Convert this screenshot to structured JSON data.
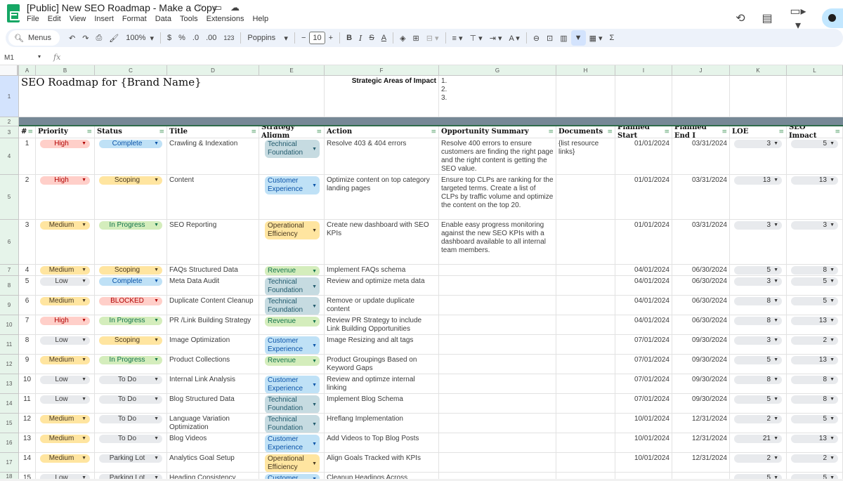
{
  "app": {
    "doc_title": "[Public] New SEO Roadmap - Make a Copy",
    "title_icons": [
      "star-icon",
      "move-to-folder-icon",
      "cloud-status-icon"
    ],
    "menu": [
      "File",
      "Edit",
      "View",
      "Insert",
      "Format",
      "Data",
      "Tools",
      "Extensions",
      "Help"
    ],
    "right_icons": [
      "version-history-icon",
      "comments-icon",
      "meet-icon"
    ]
  },
  "toolbar": {
    "search_menus": "Menus",
    "zoom": "100%",
    "currency": "$",
    "percent": "%",
    "decrease_decimal": ".0",
    "increase_decimal": ".00",
    "more_formats": "123",
    "font": "Poppins",
    "font_size": "10",
    "minus": "−",
    "plus": "+",
    "bold": "B",
    "italic": "I",
    "sum": "Σ"
  },
  "formula_bar": {
    "cell_ref": "M1",
    "fx": "fx",
    "value": ""
  },
  "columns": [
    "A",
    "B",
    "C",
    "D",
    "E",
    "F",
    "G",
    "H",
    "I",
    "J",
    "K",
    "L"
  ],
  "sheet": {
    "title": "SEO Roadmap for {Brand Name}",
    "strategic_label": "Strategic Areas of Impact",
    "strategic_list": "1.\n2.\n3.",
    "headers": [
      "#",
      "Priority",
      "Status",
      "Title",
      "Strategy Alignm",
      "Action",
      "Opportunity Summary",
      "Documents",
      "Planned Start",
      "Planned End I",
      "LOE",
      "SEO Impact"
    ],
    "row_numbers": [
      "1",
      "2",
      "3",
      "4",
      "5",
      "6",
      "7",
      "8",
      "9",
      "10",
      "11",
      "12",
      "13",
      "14",
      "15",
      "16",
      "17",
      "18"
    ],
    "rows": [
      {
        "n": "1",
        "priority": "High",
        "status": "Complete",
        "title": "Crawling & Indexation",
        "strategy": "Technical Foundation",
        "action": "Resolve 403 & 404 errors",
        "summary": "Resolve 400 errors to ensure customers are finding the right page and the right content is getting the SEO value.",
        "docs": "{list resource links}",
        "start": "01/01/2024",
        "end": "03/31/2024",
        "loe": "3",
        "impact": "5"
      },
      {
        "n": "2",
        "priority": "High",
        "status": "Scoping",
        "title": "Content",
        "strategy": "Customer Experience",
        "action": "Optimize content on top category landing pages",
        "summary": "Ensure top CLPs are ranking for the targeted terms. Create a list of CLPs by traffic volume and optimize the content on the top 20.",
        "docs": "",
        "start": "01/01/2024",
        "end": "03/31/2024",
        "loe": "13",
        "impact": "13"
      },
      {
        "n": "3",
        "priority": "Medium",
        "status": "In Progress",
        "title": "SEO Reporting",
        "strategy": "Operational Efficiency",
        "action": "Create new dashboard with SEO KPIs",
        "summary": "Enable easy progress monitoring against the new SEO KPIs with a dashboard available to all internal team members.",
        "docs": "",
        "start": "01/01/2024",
        "end": "03/31/2024",
        "loe": "3",
        "impact": "3"
      },
      {
        "n": "4",
        "priority": "Medium",
        "status": "Scoping",
        "title": "FAQs Structured Data",
        "strategy": "Revenue",
        "action": "Implement FAQs schema",
        "summary": "",
        "docs": "",
        "start": "04/01/2024",
        "end": "06/30/2024",
        "loe": "5",
        "impact": "8"
      },
      {
        "n": "5",
        "priority": "Low",
        "status": "Complete",
        "title": "Meta Data Audit",
        "strategy": "Technical Foundation",
        "action": "Review and optimize meta data",
        "summary": "",
        "docs": "",
        "start": "04/01/2024",
        "end": "06/30/2024",
        "loe": "3",
        "impact": "5"
      },
      {
        "n": "6",
        "priority": "Medium",
        "status": "BLOCKED",
        "title": "Duplicate Content Cleanup",
        "strategy": "Technical Foundation",
        "action": "Remove or update duplicate content",
        "summary": "",
        "docs": "",
        "start": "04/01/2024",
        "end": "06/30/2024",
        "loe": "8",
        "impact": "5"
      },
      {
        "n": "7",
        "priority": "High",
        "status": "In Progress",
        "title": "PR /Link Building Strategy",
        "strategy": "Revenue",
        "action": "Review PR Strategy to include Link Building Opportunities",
        "summary": "",
        "docs": "",
        "start": "04/01/2024",
        "end": "06/30/2024",
        "loe": "8",
        "impact": "13"
      },
      {
        "n": "8",
        "priority": "Low",
        "status": "Scoping",
        "title": "Image Optimization",
        "strategy": "Customer Experience",
        "action": "Image Resizing and alt tags",
        "summary": "",
        "docs": "",
        "start": "07/01/2024",
        "end": "09/30/2024",
        "loe": "3",
        "impact": "2"
      },
      {
        "n": "9",
        "priority": "Medium",
        "status": "In Progress",
        "title": "Product Collections",
        "strategy": "Revenue",
        "action": "Product Groupings Based on Keyword Gaps",
        "summary": "",
        "docs": "",
        "start": "07/01/2024",
        "end": "09/30/2024",
        "loe": "5",
        "impact": "13"
      },
      {
        "n": "10",
        "priority": "Low",
        "status": "To Do",
        "title": "Internal Link Analysis",
        "strategy": "Customer Experience",
        "action": "Review and optimze internal linking",
        "summary": "",
        "docs": "",
        "start": "07/01/2024",
        "end": "09/30/2024",
        "loe": "8",
        "impact": "8"
      },
      {
        "n": "11",
        "priority": "Low",
        "status": "To Do",
        "title": "Blog Structured Data",
        "strategy": "Technical Foundation",
        "action": "Implement Blog Schema",
        "summary": "",
        "docs": "",
        "start": "07/01/2024",
        "end": "09/30/2024",
        "loe": "5",
        "impact": "8"
      },
      {
        "n": "12",
        "priority": "Medium",
        "status": "To Do",
        "title": "Language Variation Optimization",
        "strategy": "Technical Foundation",
        "action": "Hreflang Implementation",
        "summary": "",
        "docs": "",
        "start": "10/01/2024",
        "end": "12/31/2024",
        "loe": "2",
        "impact": "5"
      },
      {
        "n": "13",
        "priority": "Medium",
        "status": "To Do",
        "title": "Blog Videos",
        "strategy": "Customer Experience",
        "action": "Add Videos to Top Blog Posts",
        "summary": "",
        "docs": "",
        "start": "10/01/2024",
        "end": "12/31/2024",
        "loe": "21",
        "impact": "13"
      },
      {
        "n": "14",
        "priority": "Medium",
        "status": "Parking Lot",
        "title": "Analytics Goal Setup",
        "strategy": "Operational Efficiency",
        "action": "Align Goals Tracked with KPIs",
        "summary": "",
        "docs": "",
        "start": "10/01/2024",
        "end": "12/31/2024",
        "loe": "2",
        "impact": "2"
      },
      {
        "n": "15",
        "priority": "Low",
        "status": "Parking Lot",
        "title": "Heading Consistency",
        "strategy": "Customer",
        "action": "Cleanup Headings Across",
        "summary": "",
        "docs": "",
        "start": "",
        "end": "",
        "loe": "5",
        "impact": "5"
      }
    ]
  },
  "chip_colors": {
    "High": {
      "bg": "#ffcfc9",
      "fg": "#b10202"
    },
    "Medium": {
      "bg": "#ffe5a0",
      "fg": "#473821"
    },
    "Low": {
      "bg": "#e8eaed",
      "fg": "#3c3c3c"
    },
    "Complete": {
      "bg": "#bfe1f6",
      "fg": "#0a53a8"
    },
    "Scoping": {
      "bg": "#ffe5a0",
      "fg": "#473821"
    },
    "In Progress": {
      "bg": "#d4edbc",
      "fg": "#11734b"
    },
    "BLOCKED": {
      "bg": "#ffcfc9",
      "fg": "#b10202"
    },
    "To Do": {
      "bg": "#e8eaed",
      "fg": "#3c3c3c"
    },
    "Parking Lot": {
      "bg": "#e8eaed",
      "fg": "#3c3c3c"
    },
    "Technical Foundation": {
      "bg": "#c6dbe1",
      "fg": "#215a6c"
    },
    "Customer Experience": {
      "bg": "#bfe1f6",
      "fg": "#0a53a8"
    },
    "Operational Efficiency": {
      "bg": "#ffe5a0",
      "fg": "#473821"
    },
    "Revenue": {
      "bg": "#d4edbc",
      "fg": "#11734b"
    },
    "Customer": {
      "bg": "#bfe1f6",
      "fg": "#0a53a8"
    }
  }
}
